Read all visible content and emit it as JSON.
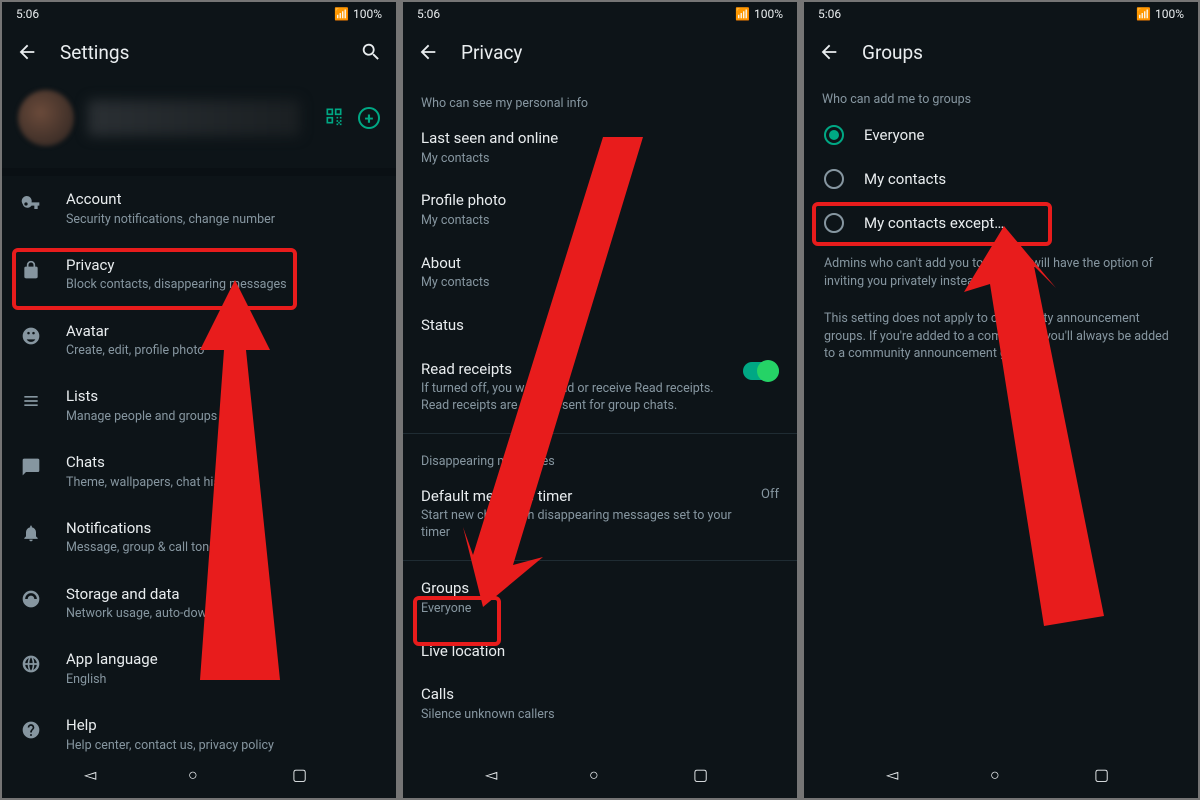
{
  "status": {
    "time": "5:06",
    "battery": "100%"
  },
  "screen1": {
    "title": "Settings",
    "items": [
      {
        "icon": "key",
        "title": "Account",
        "sub": "Security notifications, change number"
      },
      {
        "icon": "lock",
        "title": "Privacy",
        "sub": "Block contacts, disappearing messages"
      },
      {
        "icon": "face",
        "title": "Avatar",
        "sub": "Create, edit, profile photo"
      },
      {
        "icon": "lists",
        "title": "Lists",
        "sub": "Manage people and groups"
      },
      {
        "icon": "chats",
        "title": "Chats",
        "sub": "Theme, wallpapers, chat history"
      },
      {
        "icon": "bell",
        "title": "Notifications",
        "sub": "Message, group & call tones"
      },
      {
        "icon": "data",
        "title": "Storage and data",
        "sub": "Network usage, auto-download"
      },
      {
        "icon": "globe",
        "title": "App language",
        "sub": "English"
      },
      {
        "icon": "help",
        "title": "Help",
        "sub": "Help center, contact us, privacy policy"
      }
    ]
  },
  "screen2": {
    "title": "Privacy",
    "section1": "Who can see my personal info",
    "items1": [
      {
        "title": "Last seen and online",
        "sub": "My contacts"
      },
      {
        "title": "Profile photo",
        "sub": "My contacts"
      },
      {
        "title": "About",
        "sub": "My contacts"
      },
      {
        "title": "Status",
        "sub": ""
      }
    ],
    "receipts": {
      "title": "Read receipts",
      "sub": "If turned off, you won't send or receive Read receipts. Read receipts are always sent for group chats."
    },
    "section2": "Disappearing messages",
    "timer": {
      "title": "Default message timer",
      "sub": "Start new chats with disappearing messages set to your timer",
      "value": "Off"
    },
    "items2": [
      {
        "title": "Groups",
        "sub": "Everyone"
      },
      {
        "title": "Live location",
        "sub": ""
      },
      {
        "title": "Calls",
        "sub": "Silence unknown callers"
      }
    ]
  },
  "screen3": {
    "title": "Groups",
    "section": "Who can add me to groups",
    "options": [
      {
        "label": "Everyone",
        "selected": true
      },
      {
        "label": "My contacts",
        "selected": false
      },
      {
        "label": "My contacts except…",
        "selected": false
      }
    ],
    "info1": "Admins who can't add you to a group will have the option of inviting you privately instead.",
    "info2": "This setting does not apply to community announcement groups. If you're added to a community, you'll always be added to a community announcement group."
  }
}
